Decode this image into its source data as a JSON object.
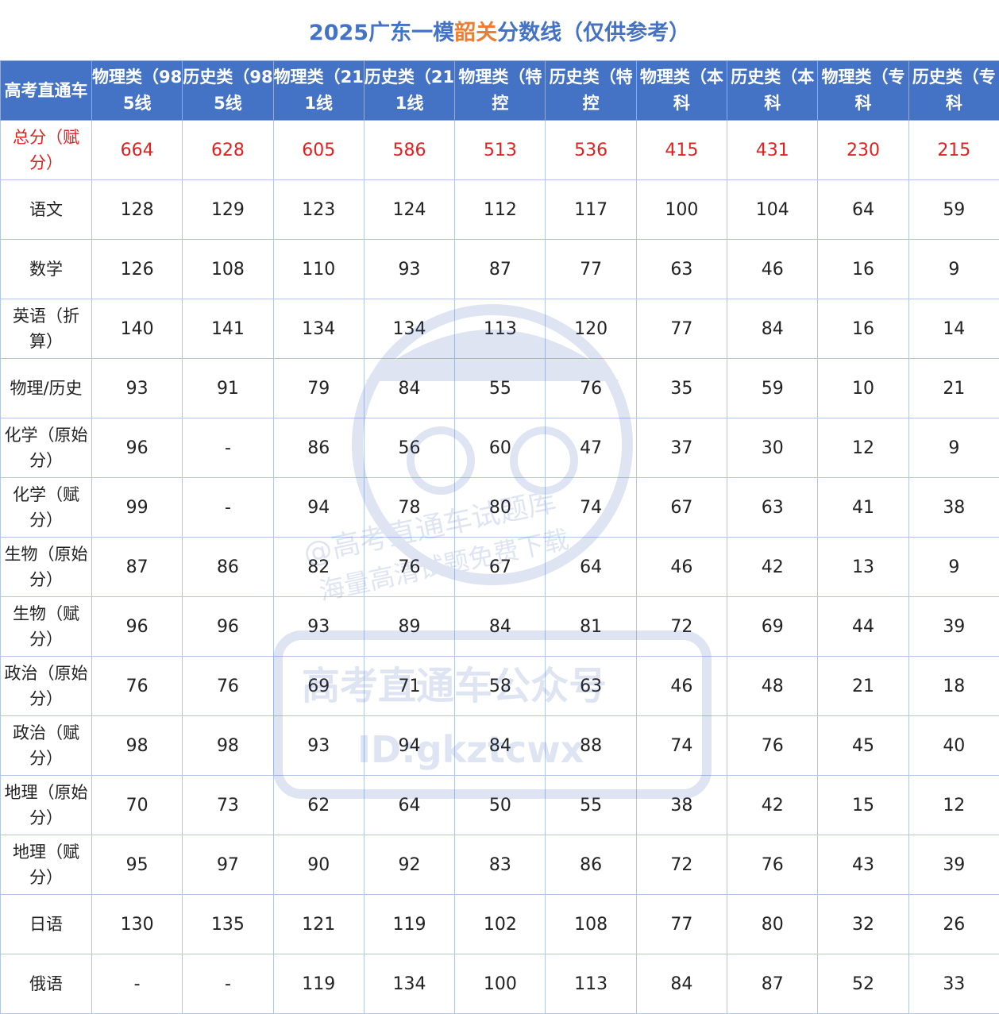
{
  "title": {
    "prefix": "2025广东一模",
    "highlight": "韶关",
    "suffix": "分数线（仅供参考）"
  },
  "colors": {
    "header_bg": "#4472c4",
    "highlight": "#ed7d31",
    "total_text": "#e02020"
  },
  "table": {
    "corner": "高考直通车",
    "headers": [
      "物理类（985线",
      "历史类（985线",
      "物理类（211线",
      "历史类（211线",
      "物理类（特控",
      "历史类（特控",
      "物理类（本科",
      "历史类（本科",
      "物理类（专科",
      "历史类（专科"
    ],
    "rows": [
      {
        "label": "总分（赋分）",
        "values": [
          "664",
          "628",
          "605",
          "586",
          "513",
          "536",
          "415",
          "431",
          "230",
          "215"
        ]
      },
      {
        "label": "语文",
        "values": [
          "128",
          "129",
          "123",
          "124",
          "112",
          "117",
          "100",
          "104",
          "64",
          "59"
        ]
      },
      {
        "label": "数学",
        "values": [
          "126",
          "108",
          "110",
          "93",
          "87",
          "77",
          "63",
          "46",
          "16",
          "9"
        ]
      },
      {
        "label": "英语（折算）",
        "values": [
          "140",
          "141",
          "134",
          "134",
          "113",
          "120",
          "77",
          "84",
          "16",
          "14"
        ]
      },
      {
        "label": "物理/历史",
        "values": [
          "93",
          "91",
          "79",
          "84",
          "55",
          "76",
          "35",
          "59",
          "10",
          "21"
        ]
      },
      {
        "label": "化学（原始分）",
        "values": [
          "96",
          "-",
          "86",
          "56",
          "60",
          "47",
          "37",
          "30",
          "12",
          "9"
        ]
      },
      {
        "label": "化学（赋分）",
        "values": [
          "99",
          "-",
          "94",
          "78",
          "80",
          "74",
          "67",
          "63",
          "41",
          "38"
        ]
      },
      {
        "label": "生物（原始分）",
        "values": [
          "87",
          "86",
          "82",
          "76",
          "67",
          "64",
          "46",
          "42",
          "13",
          "9"
        ]
      },
      {
        "label": "生物（赋分）",
        "values": [
          "96",
          "96",
          "93",
          "89",
          "84",
          "81",
          "72",
          "69",
          "44",
          "39"
        ]
      },
      {
        "label": "政治（原始分）",
        "values": [
          "76",
          "76",
          "69",
          "71",
          "58",
          "63",
          "46",
          "48",
          "21",
          "18"
        ]
      },
      {
        "label": "政治（赋分）",
        "values": [
          "98",
          "98",
          "93",
          "94",
          "84",
          "88",
          "74",
          "76",
          "45",
          "40"
        ]
      },
      {
        "label": "地理（原始分）",
        "values": [
          "70",
          "73",
          "62",
          "64",
          "50",
          "55",
          "38",
          "42",
          "15",
          "12"
        ]
      },
      {
        "label": "地理（赋分）",
        "values": [
          "95",
          "97",
          "90",
          "92",
          "83",
          "86",
          "72",
          "76",
          "43",
          "39"
        ]
      },
      {
        "label": "日语",
        "values": [
          "130",
          "135",
          "121",
          "119",
          "102",
          "108",
          "77",
          "80",
          "32",
          "26"
        ]
      },
      {
        "label": "俄语",
        "values": [
          "-",
          "-",
          "119",
          "134",
          "100",
          "113",
          "84",
          "87",
          "52",
          "33"
        ]
      }
    ]
  },
  "watermark": {
    "lines": [
      "@高考直通车试题库",
      "海量高清试题免费下载",
      "高考直通车公众号",
      "ID:gkztcwx"
    ]
  }
}
